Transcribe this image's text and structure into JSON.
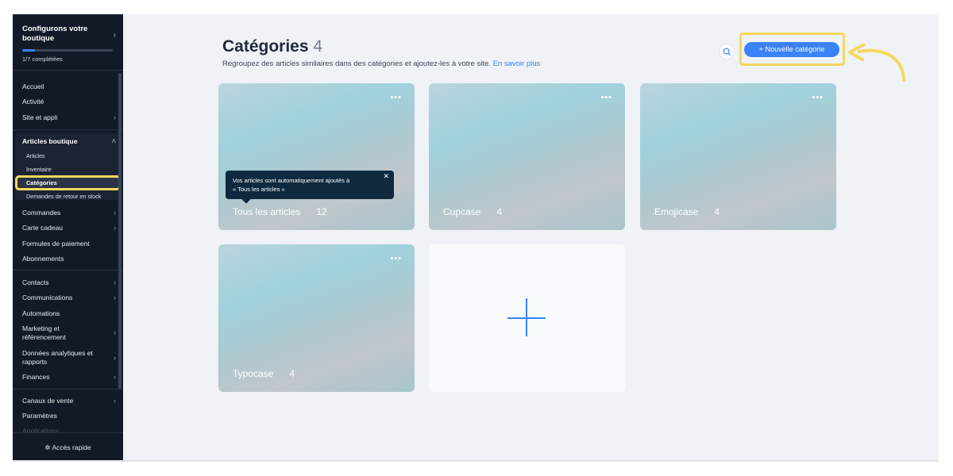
{
  "sidebar": {
    "setup_title": "Configurons votre boutique",
    "progress_label": "1/7 complétées",
    "progress_fraction": 0.14,
    "items_top": [
      "Accueil",
      "Activité",
      "Site et appli"
    ],
    "section_title": "Articles boutique",
    "sub_items": [
      "Articles",
      "Inventaire",
      "Catégories",
      "Demandes de retour en stock"
    ],
    "items_mid": [
      "Commandes",
      "Carte cadeau",
      "Formules de paiement",
      "Abonnements"
    ],
    "items_lower": [
      "Contacts",
      "Communications",
      "Automations",
      "Marketing et référencement",
      "Données analytiques et rapports",
      "Finances"
    ],
    "items_bottom": [
      "Canaux de vente",
      "Paramètres"
    ],
    "faded_item": "Applications",
    "quick_access": "Accès rapide"
  },
  "header": {
    "title": "Catégories",
    "count": "4",
    "subtitle": "Regroupez des articles similaires dans des catégories et ajoutez-les à votre site.",
    "learn_more": "En savoir plus",
    "new_button": "+ Nouvelle catégorie"
  },
  "tooltip": {
    "text_line1": "Vos articles sont automatiquement ajoutés à",
    "text_line2": "« Tous les articles »"
  },
  "categories": [
    {
      "name": "Tous les articles",
      "count": "12"
    },
    {
      "name": "Cupcase",
      "count": "4"
    },
    {
      "name": "Emojicase",
      "count": "4"
    },
    {
      "name": "Typocase",
      "count": "4"
    }
  ],
  "colors": {
    "accent": "#3b82f6",
    "highlight": "#f5d85e",
    "sidebar": "#131a27"
  },
  "icons": {
    "search": "search-icon",
    "add": "plus-icon",
    "more": "more-dots-icon",
    "close": "close-icon"
  }
}
